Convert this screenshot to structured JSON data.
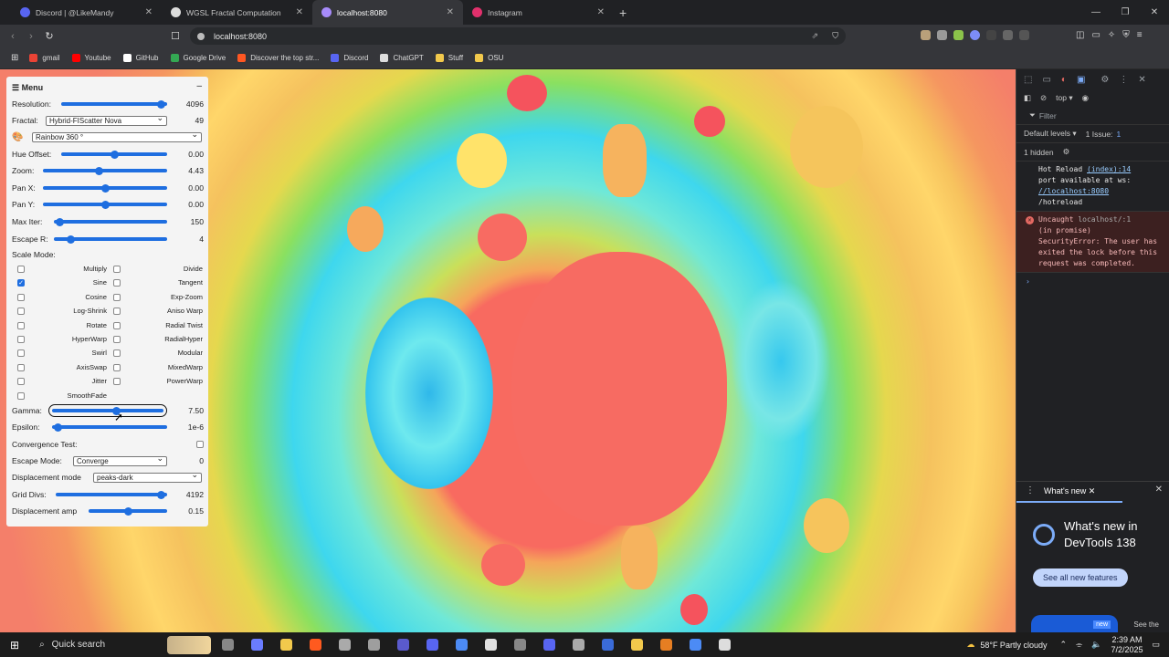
{
  "tabs": [
    {
      "label": "Discord | @LikeMandy",
      "color": "#5865f2",
      "active": false
    },
    {
      "label": "WGSL Fractal Computation",
      "color": "#ddd",
      "active": false
    },
    {
      "label": "localhost:8080",
      "color": "#a78bfa",
      "active": true
    },
    {
      "label": "Instagram",
      "color": "#e1306c",
      "active": false
    }
  ],
  "newtab": "+",
  "url": "localhost:8080",
  "bookmarks": [
    {
      "label": "gmail",
      "color": "#ea4335"
    },
    {
      "label": "Youtube",
      "color": "#ff0000"
    },
    {
      "label": "GitHub",
      "color": "#ffffff"
    },
    {
      "label": "Google Drive",
      "color": "#34a853"
    },
    {
      "label": "Discover the top str...",
      "color": "#ff5722"
    },
    {
      "label": "Discord",
      "color": "#5865f2"
    },
    {
      "label": "ChatGPT",
      "color": "#dddddd"
    },
    {
      "label": "Stuff",
      "color": "#f2c94c"
    },
    {
      "label": "OSU",
      "color": "#f2c94c"
    }
  ],
  "menu": {
    "title": "Menu",
    "minimize": "–",
    "resolution": {
      "label": "Resolution:",
      "value": "4096",
      "pos": 0.98
    },
    "fractal": {
      "label": "Fractal:",
      "selected": "Hybrid-FIScatter Nova",
      "value": "49"
    },
    "palette": {
      "selected": "Rainbow 360 °"
    },
    "hue": {
      "label": "Hue Offset:",
      "value": "0.00",
      "pos": 0.5
    },
    "zoom": {
      "label": "Zoom:",
      "value": "4.43",
      "pos": 0.45
    },
    "panx": {
      "label": "Pan X:",
      "value": "0.00",
      "pos": 0.5
    },
    "pany": {
      "label": "Pan Y:",
      "value": "0.00",
      "pos": 0.5
    },
    "maxiter": {
      "label": "Max Iter:",
      "value": "150",
      "pos": 0.02
    },
    "escaper": {
      "label": "Escape R:",
      "value": "4",
      "pos": 0.12
    },
    "scalemode_label": "Scale Mode:",
    "scale_left": [
      {
        "label": "Multiply",
        "checked": false
      },
      {
        "label": "Sine",
        "checked": true
      },
      {
        "label": "Cosine",
        "checked": false
      },
      {
        "label": "Log-Shrink",
        "checked": false
      },
      {
        "label": "Rotate",
        "checked": false
      },
      {
        "label": "HyperWarp",
        "checked": false
      },
      {
        "label": "Swirl",
        "checked": false
      },
      {
        "label": "AxisSwap",
        "checked": false
      },
      {
        "label": "Jitter",
        "checked": false
      },
      {
        "label": "SmoothFade",
        "checked": false
      }
    ],
    "scale_right": [
      {
        "label": "Divide",
        "checked": false
      },
      {
        "label": "Tangent",
        "checked": false
      },
      {
        "label": "Exp-Zoom",
        "checked": false
      },
      {
        "label": "Aniso Warp",
        "checked": false
      },
      {
        "label": "Radial Twist",
        "checked": false
      },
      {
        "label": "RadialHyper",
        "checked": false
      },
      {
        "label": "Modular",
        "checked": false
      },
      {
        "label": "MixedWarp",
        "checked": false
      },
      {
        "label": "PowerWarp",
        "checked": false
      }
    ],
    "gamma": {
      "label": "Gamma:",
      "value": "7.50",
      "pos": 0.58
    },
    "epsilon": {
      "label": "Epsilon:",
      "value": "1e-6",
      "pos": 0.02
    },
    "convergence": {
      "label": "Convergence Test:",
      "checked": false
    },
    "escapemode": {
      "label": "Escape Mode:",
      "selected": "Converge",
      "value": "0"
    },
    "displacement_mode": {
      "label": "Displacement mode",
      "selected": "peaks-dark"
    },
    "griddivs": {
      "label": "Grid Divs:",
      "value": "4192",
      "pos": 0.98
    },
    "displacement_amp": {
      "label": "Displacement amp",
      "value": "0.15",
      "pos": 0.5
    }
  },
  "devtools": {
    "context": "top ▾",
    "filter": "Filter",
    "levels": "Default levels ▾",
    "issues": "1 Issue:",
    "issues_count": "1",
    "hidden": "1 hidden",
    "hot_reload_1": "Hot Reload",
    "hot_reload_src": "(index):14",
    "hot_reload_2": "port available at ws:",
    "hot_reload_link": "//localhost:8080",
    "hot_reload_3": "/hotreload",
    "err_1": "Uncaught",
    "err_src": "localhost/:1",
    "err_2": "(in promise)",
    "err_3": "SecurityError: The user has exited the lock before this request was completed.",
    "prompt": "›",
    "whatsnew_tab": "What's new",
    "whatsnew_title": "What's new in DevTools 138",
    "whatsnew_btn": "See all new features",
    "see_the": "See the",
    "new_badge": "new"
  },
  "taskbar": {
    "search": "Quick search",
    "weather": "58°F Partly cloudy",
    "time": "2:39 AM",
    "date": "7/2/2025"
  }
}
